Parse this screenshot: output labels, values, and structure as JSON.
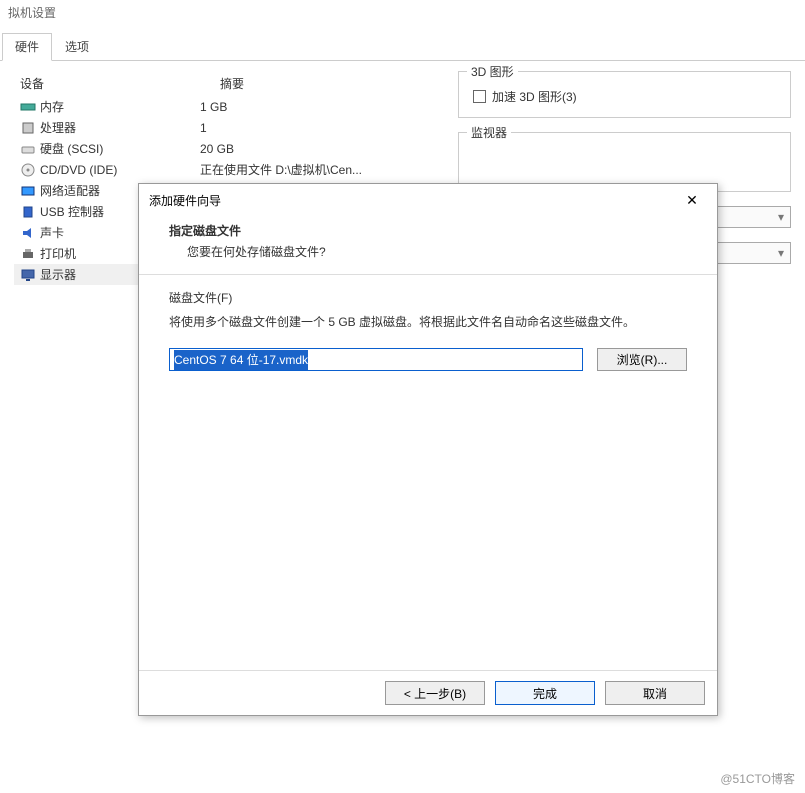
{
  "window": {
    "title": "拟机设置"
  },
  "tabs": {
    "hardware": "硬件",
    "options": "选项"
  },
  "hw_table": {
    "device_header": "设备",
    "summary_header": "摘要",
    "rows": [
      {
        "icon": "memory-icon",
        "device": "内存",
        "summary": "1 GB"
      },
      {
        "icon": "cpu-icon",
        "device": "处理器",
        "summary": "1"
      },
      {
        "icon": "disk-icon",
        "device": "硬盘 (SCSI)",
        "summary": "20 GB"
      },
      {
        "icon": "cd-icon",
        "device": "CD/DVD (IDE)",
        "summary": "正在使用文件 D:\\虚拟机\\Cen..."
      },
      {
        "icon": "network-icon",
        "device": "网络适配器",
        "summary": ""
      },
      {
        "icon": "usb-icon",
        "device": "USB 控制器",
        "summary": ""
      },
      {
        "icon": "sound-icon",
        "device": "声卡",
        "summary": ""
      },
      {
        "icon": "printer-icon",
        "device": "打印机",
        "summary": ""
      },
      {
        "icon": "display-icon",
        "device": "显示器",
        "summary": ""
      }
    ]
  },
  "right": {
    "group_3d_title": "3D 图形",
    "accel_label": "加速 3D 图形(3)",
    "group_monitors_title": "监视器"
  },
  "dialog": {
    "title": "添加硬件向导",
    "heading": "指定磁盘文件",
    "subheading": "您要在何处存储磁盘文件?",
    "file_label": "磁盘文件(F)",
    "description": "将使用多个磁盘文件创建一个 5 GB 虚拟磁盘。将根据此文件名自动命名这些磁盘文件。",
    "file_value": "CentOS 7 64 位-17.vmdk",
    "browse": "浏览(R)...",
    "back": "< 上一步(B)",
    "finish": "完成",
    "cancel": "取消"
  },
  "watermark": "@51CTO博客"
}
